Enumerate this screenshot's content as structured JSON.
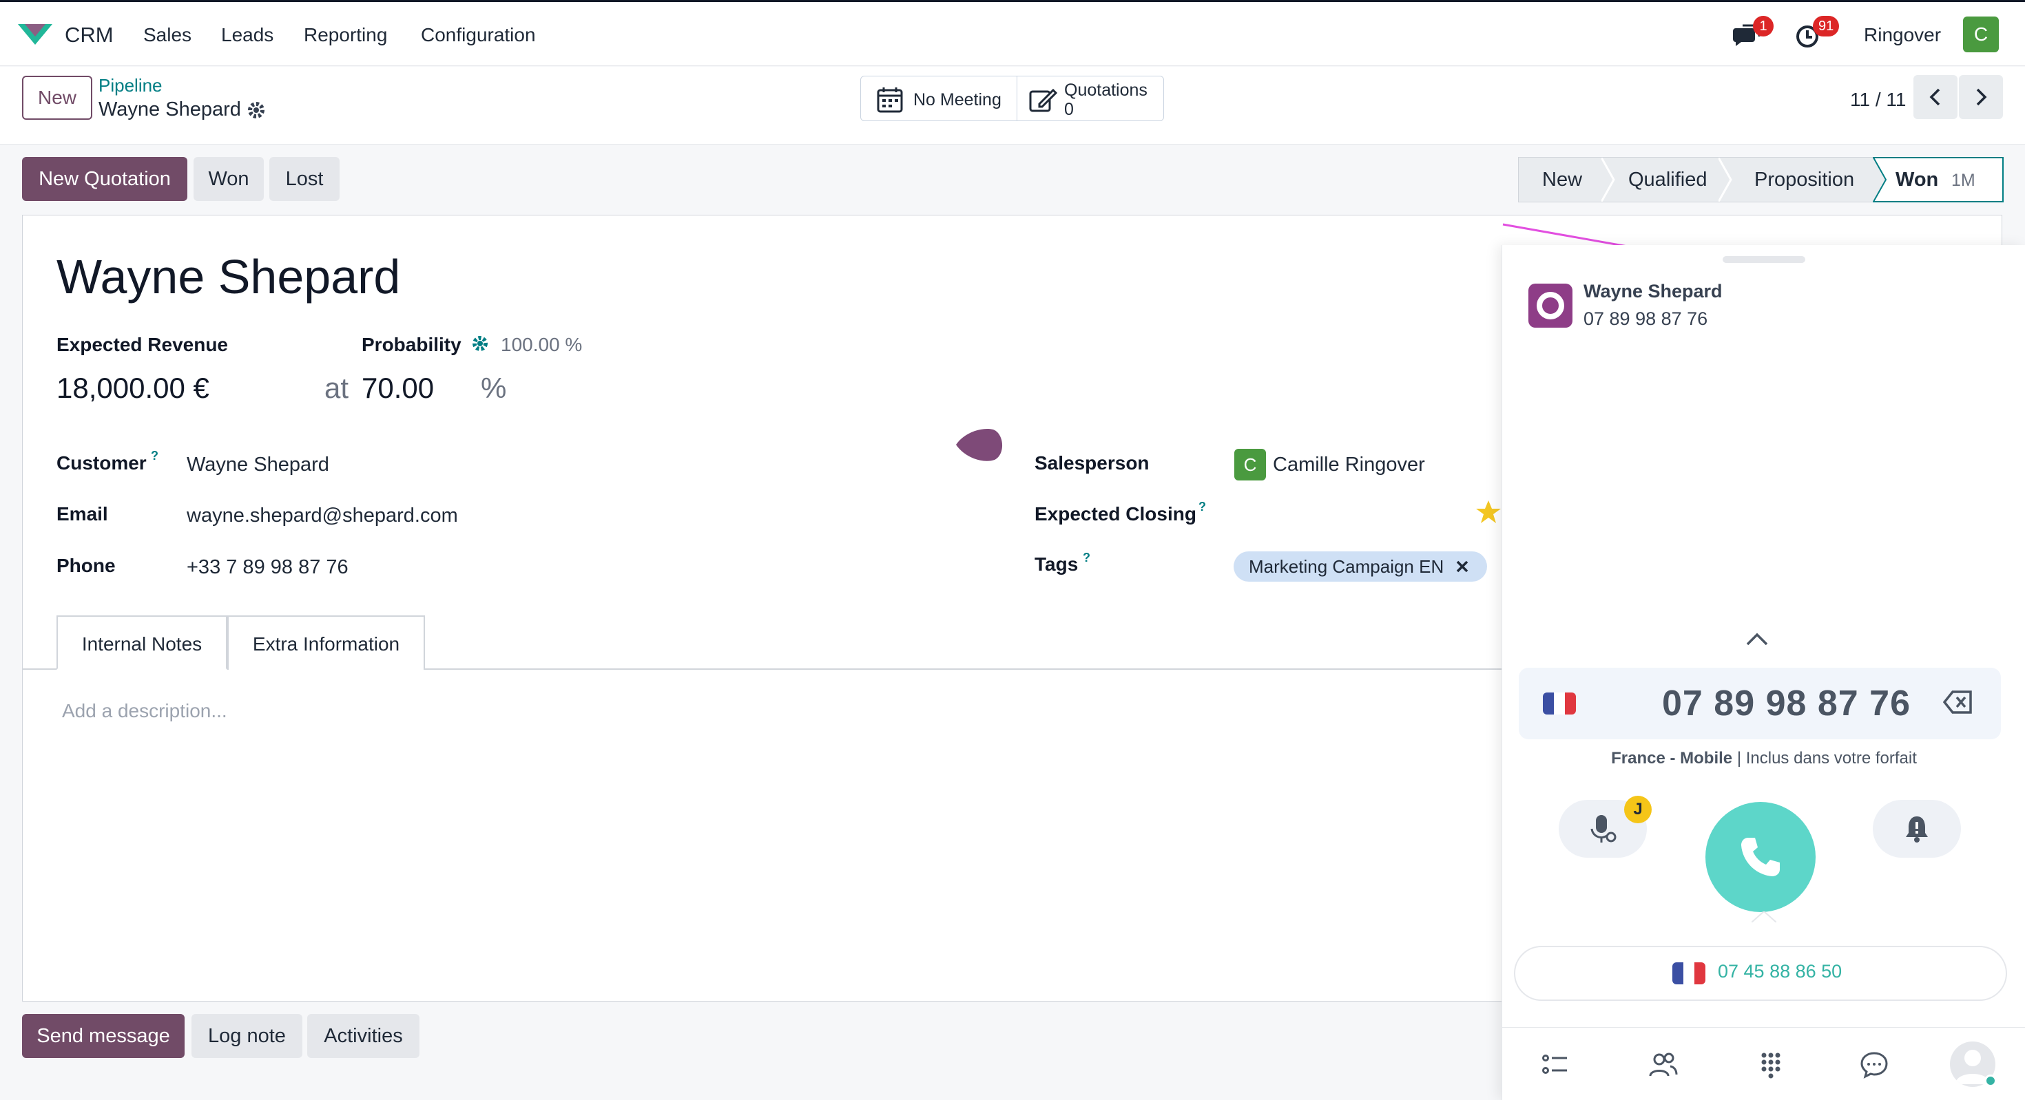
{
  "topbar": {
    "app_name": "CRM",
    "menu": [
      "Sales",
      "Leads",
      "Reporting",
      "Configuration"
    ],
    "messages_count": "1",
    "activities_count": "91",
    "company": "Ringover",
    "user_initial": "C"
  },
  "control": {
    "new_label": "New",
    "breadcrumb_parent": "Pipeline",
    "breadcrumb_current": "Wayne Shepard",
    "meeting_label": "No Meeting",
    "quotations_label": "Quotations",
    "quotations_count": "0",
    "pager": "11 / 11"
  },
  "actions": {
    "new_quotation": "New Quotation",
    "won": "Won",
    "lost": "Lost"
  },
  "stages": {
    "items": [
      "New",
      "Qualified",
      "Proposition",
      "Won"
    ],
    "won_duration": "1M",
    "current": "Won"
  },
  "lead": {
    "name": "Wayne Shepard",
    "expected_revenue_label": "Expected Revenue",
    "expected_revenue": "18,000.00 €",
    "at": "at",
    "probability_label": "Probability",
    "probability_auto": "100.00 %",
    "probability": "70.00",
    "percent": "%",
    "customer_label": "Customer",
    "customer": "Wayne Shepard",
    "email_label": "Email",
    "email": "wayne.shepard@shepard.com",
    "phone_label": "Phone",
    "phone": "+33 7 89 98 87 76",
    "salesperson_label": "Salesperson",
    "salesperson_initial": "C",
    "salesperson": "Camille Ringover",
    "expected_closing_label": "Expected Closing",
    "tags_label": "Tags",
    "tag": "Marketing Campaign EN",
    "help_mark": "?"
  },
  "tabs": {
    "internal_notes": "Internal Notes",
    "extra_information": "Extra Information",
    "description_placeholder": "Add a description..."
  },
  "chatter": {
    "send_message": "Send message",
    "log_note": "Log note",
    "activities": "Activities"
  },
  "dialer": {
    "contact_name": "Wayne Shepard",
    "contact_phone": "07 89 98 87 76",
    "dial_number": "07 89 98 87 76",
    "network_bold": "France - Mobile",
    "network_sep": " | ",
    "network_rest": "Inclus dans votre forfait",
    "voicemail_badge": "J",
    "from_number": "07 45 88 86 50"
  },
  "colors": {
    "brand": "#714b67",
    "accent_teal": "#017e84",
    "call_green": "#5dd6c9",
    "ringover_purple": "#8e3d87"
  }
}
